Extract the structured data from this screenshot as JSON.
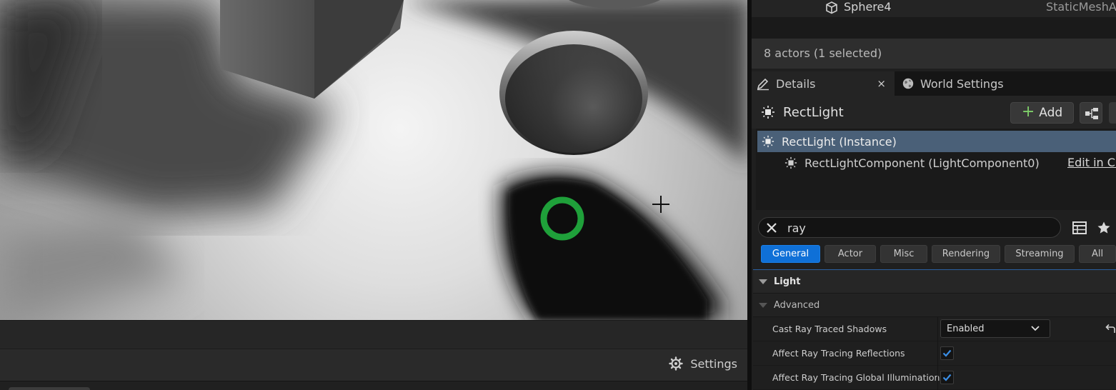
{
  "outliner": {
    "row_name": "Sphere4",
    "row_type": "StaticMeshA",
    "actor_count": "8 actors (1 selected)"
  },
  "tabs": {
    "details": "Details",
    "world_settings": "World Settings",
    "close_glyph": "×"
  },
  "details": {
    "title": "RectLight",
    "add_label": "Add",
    "add_glyph": "+"
  },
  "components": {
    "root": "RectLight (Instance)",
    "child": "RectLightComponent (LightComponent0)",
    "edit_link": "Edit in C+"
  },
  "search": {
    "value": "ray"
  },
  "filters": [
    "General",
    "Actor",
    "Misc",
    "Rendering",
    "Streaming",
    "All"
  ],
  "categories": {
    "light": "Light",
    "advanced": "Advanced"
  },
  "properties": {
    "cast_shadows": {
      "label": "Cast Ray Traced Shadows",
      "value": "Enabled"
    },
    "affect_reflections": {
      "label": "Affect Ray Tracing Reflections",
      "checked": true
    },
    "affect_gi": {
      "label": "Affect Ray Tracing Global Illumination",
      "checked": true
    }
  },
  "viewport": {
    "settings_label": "Settings"
  },
  "colors": {
    "accent_blue": "#0f70d7",
    "selection": "#4a6078",
    "add_plus": "#7fd06a",
    "gizmo_green": "#1fa03a"
  }
}
